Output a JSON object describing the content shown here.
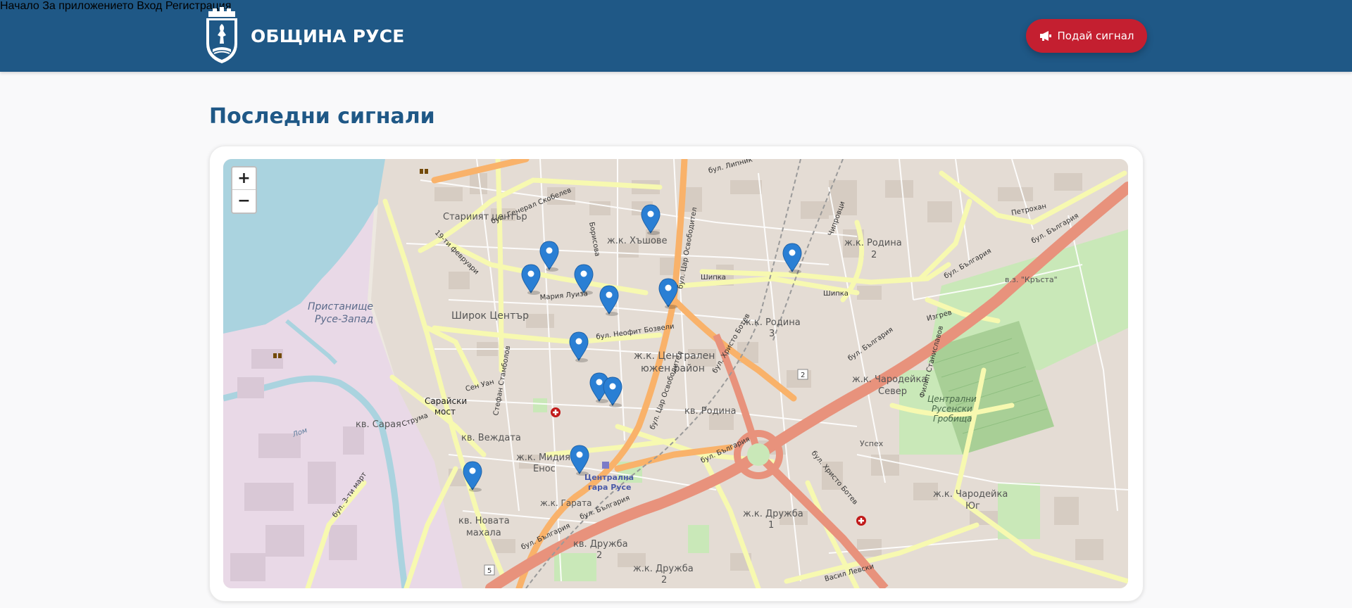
{
  "header": {
    "brand_name": "ОБЩИНА РУСЕ",
    "nav": [
      "Начало",
      "За приложението",
      "Вход",
      "Регистрация"
    ],
    "report_button": "Подай сигнал"
  },
  "page_title": "Последни сигнали",
  "map": {
    "zoom_in": "+",
    "zoom_out": "−",
    "labels": {
      "old_center": "Стариият център",
      "hashove": "ж.к. Хъшове",
      "rodina2": "ж.к. Родина",
      "rodina2_num": "2",
      "port": "Пристанище",
      "port2": "Русе-Запад",
      "wide_center": "Широк Център",
      "central_south": "ж.к. Централен",
      "central_south2": "южен район",
      "rodina3": "ж.к. Родина",
      "rodina3_num": "3",
      "chardeyka_north": "ж.к. Чародейка",
      "chardeyka_north2": "Север",
      "cemetery": "Централни",
      "cemetery2": "Русенски",
      "cemetery3": "Гробища",
      "sarayski_most": "Сарайски",
      "sarayski_most2": "мост",
      "sarayka": "кв. Сарая",
      "vezhdata": "кв. Веждата",
      "midia_enos": "ж.к. Мидия",
      "midia_enos2": "Енос",
      "central_station": "Централна",
      "central_station2": "гара Русе",
      "rodina_kv": "кв. Родина",
      "chardeyka_south": "ж.к. Чародейка",
      "chardeyka_south2": "Юг",
      "gara": "ж.к. Гарата",
      "novata_mahala": "кв. Новата",
      "novata_mahala2": "махала",
      "druzhba1": "ж.к. Дружба",
      "druzhba1_num": "1",
      "druzhba2": "кв. Дружба",
      "druzhba2_num": "2",
      "druzhba2b": "ж.к. Дружба",
      "druzhba2b_num": "2",
      "krasta": "в.з. \"Кръста\"",
      "uspeh": "Успех",
      "road_bulgaria": "бул. България",
      "road_tsar": "бул. Цар Освободител",
      "road_botev": "бул. Христо Ботев",
      "road_skobelev": "бул. Генерал Скобелев",
      "road_shipka": "Шипка",
      "road_neofit": "бул. Неофит Бозвели",
      "road_19feb": "19-ти февруари",
      "road_stambolov": "Стефан Стамболов",
      "road_lipnik": "бул. Липник",
      "road_izgrev": "Изгрев",
      "road_3mart": "бул. 3-ти март",
      "road_vasil_levski": "Васил Левски",
      "road_chiprovtsi": "Чипровци",
      "road_maria_luiza": "Мария Луиза",
      "road_borisova": "Борисова",
      "road_struma": "Струма",
      "road_sen_uan": "Сен Уан",
      "road_lom": "Лом",
      "road_petrohan": "Петрохан",
      "road_filip": "Филип Станиславов",
      "road_marker2": "2",
      "road_marker5": "5"
    },
    "markers": 13
  },
  "colors": {
    "header": "#1f5886",
    "accent": "#c41f30",
    "marker": "#2a7fd4",
    "water": "#aad3df",
    "motorway": "#e8927c",
    "primary": "#f9b26a",
    "secondary": "#f7f9b0"
  }
}
